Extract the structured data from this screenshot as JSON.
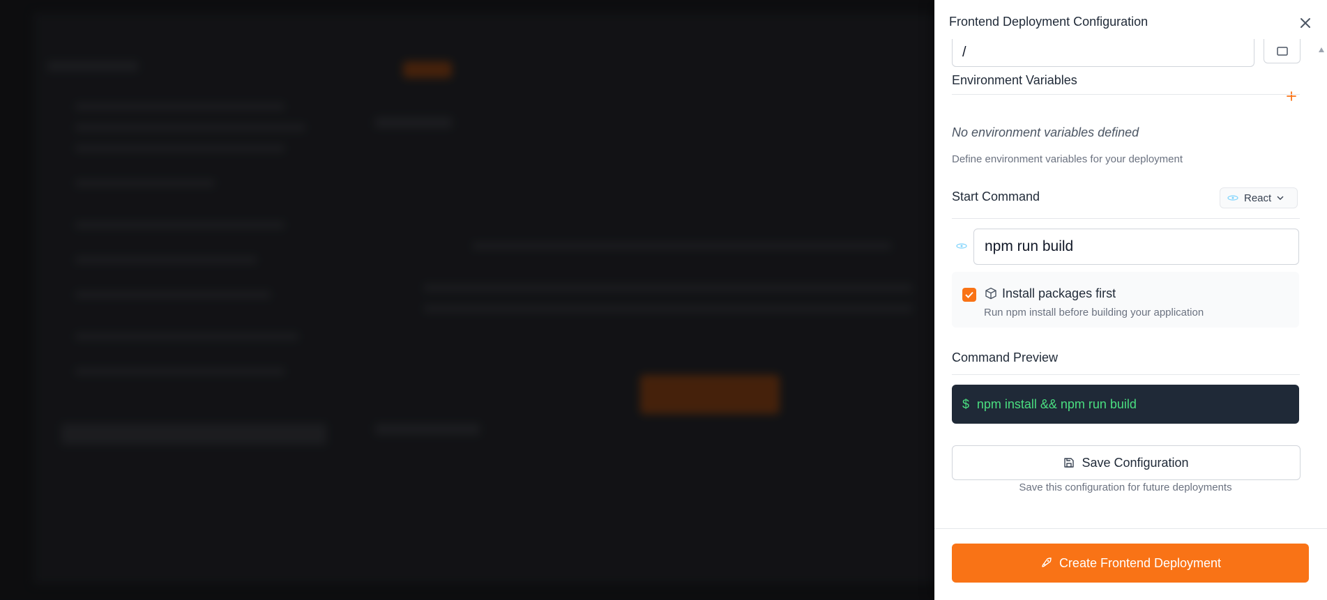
{
  "drawer": {
    "title": "Frontend Deployment Configuration",
    "root_path_value": "/"
  },
  "env": {
    "title": "Environment Variables",
    "empty_text": "No environment variables defined",
    "help": "Define environment variables for your deployment"
  },
  "start": {
    "title": "Start Command",
    "framework": "React",
    "command_value": "npm run build",
    "install_label": "Install packages first",
    "install_help": "Run npm install before building your application",
    "install_checked": true
  },
  "preview": {
    "title": "Command Preview",
    "prompt": "$",
    "command": "npm install && npm run build"
  },
  "save": {
    "label": "Save Configuration",
    "help": "Save this configuration for future deployments"
  },
  "footer": {
    "deploy_label": "Create Frontend Deployment"
  },
  "colors": {
    "accent": "#f97316",
    "preview_bg": "#1f2937",
    "preview_text": "#4ade80"
  }
}
